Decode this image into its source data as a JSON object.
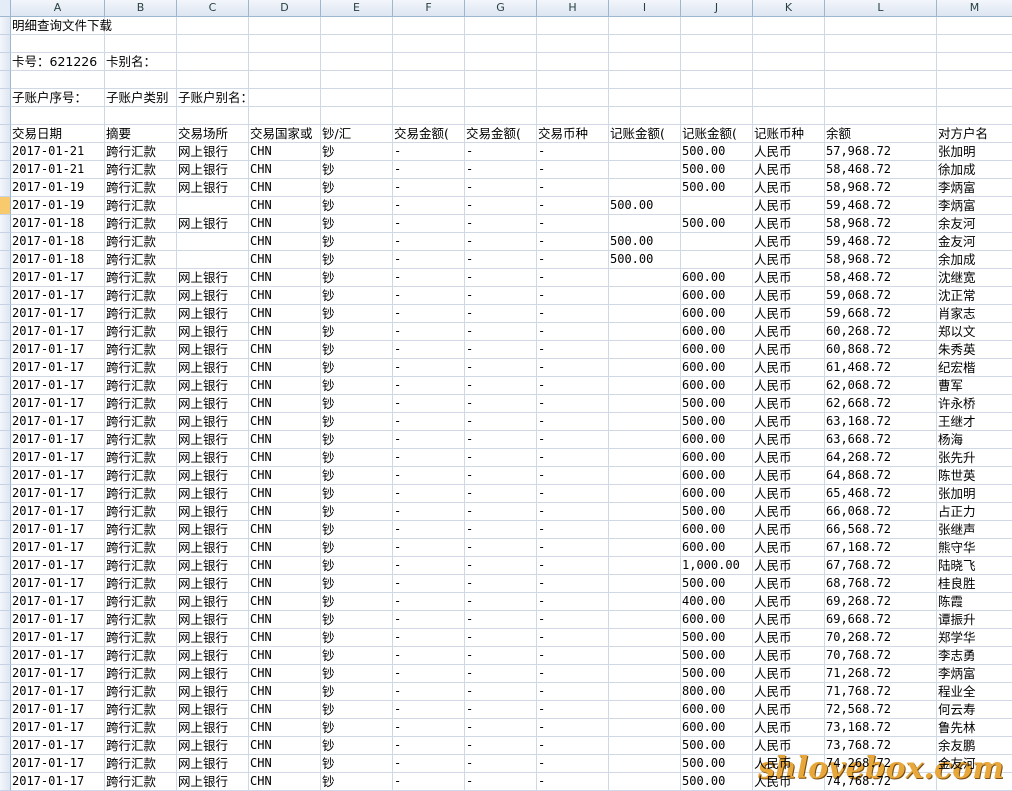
{
  "columns": [
    "A",
    "B",
    "C",
    "D",
    "E",
    "F",
    "G",
    "H",
    "I",
    "J",
    "K",
    "L",
    "M"
  ],
  "info": {
    "title": "明细查询文件下载",
    "card_no": "卡号：621226",
    "card_alias": "卡别名：",
    "sub_seq": "子账户序号：",
    "sub_type": "子账户类别",
    "sub_alias": "子账户别名："
  },
  "headers": [
    "交易日期",
    "摘要",
    "交易场所",
    "交易国家或",
    "钞/汇",
    "交易金额(",
    "交易金额(",
    "交易币种",
    "记账金额(",
    "记账金额(",
    "记账币种",
    "余额",
    "对方户名"
  ],
  "rows": [
    [
      "2017-01-21",
      "跨行汇款",
      "网上银行",
      "CHN",
      "钞",
      "-",
      "-",
      "-",
      "",
      "500.00",
      "人民币",
      "57,968.72",
      "张加明"
    ],
    [
      "2017-01-21",
      "跨行汇款",
      "网上银行",
      "CHN",
      "钞",
      "-",
      "-",
      "-",
      "",
      "500.00",
      "人民币",
      "58,468.72",
      "徐加成"
    ],
    [
      "2017-01-19",
      "跨行汇款",
      "网上银行",
      "CHN",
      "钞",
      "-",
      "-",
      "-",
      "",
      "500.00",
      "人民币",
      "58,968.72",
      "李炳富"
    ],
    [
      "2017-01-19",
      "跨行汇款",
      "",
      "CHN",
      "钞",
      "-",
      "-",
      "-",
      "500.00",
      "",
      "人民币",
      "59,468.72",
      "李炳富"
    ],
    [
      "2017-01-18",
      "跨行汇款",
      "网上银行",
      "CHN",
      "钞",
      "-",
      "-",
      "-",
      "",
      "500.00",
      "人民币",
      "58,968.72",
      "余友河"
    ],
    [
      "2017-01-18",
      "跨行汇款",
      "",
      "CHN",
      "钞",
      "-",
      "-",
      "-",
      "500.00",
      "",
      "人民币",
      "59,468.72",
      "金友河"
    ],
    [
      "2017-01-18",
      "跨行汇款",
      "",
      "CHN",
      "钞",
      "-",
      "-",
      "-",
      "500.00",
      "",
      "人民币",
      "58,968.72",
      "余加成"
    ],
    [
      "2017-01-17",
      "跨行汇款",
      "网上银行",
      "CHN",
      "钞",
      "-",
      "-",
      "-",
      "",
      "600.00",
      "人民币",
      "58,468.72",
      "沈继宽"
    ],
    [
      "2017-01-17",
      "跨行汇款",
      "网上银行",
      "CHN",
      "钞",
      "-",
      "-",
      "-",
      "",
      "600.00",
      "人民币",
      "59,068.72",
      "沈正常"
    ],
    [
      "2017-01-17",
      "跨行汇款",
      "网上银行",
      "CHN",
      "钞",
      "-",
      "-",
      "-",
      "",
      "600.00",
      "人民币",
      "59,668.72",
      "肖家志"
    ],
    [
      "2017-01-17",
      "跨行汇款",
      "网上银行",
      "CHN",
      "钞",
      "-",
      "-",
      "-",
      "",
      "600.00",
      "人民币",
      "60,268.72",
      "郑以文"
    ],
    [
      "2017-01-17",
      "跨行汇款",
      "网上银行",
      "CHN",
      "钞",
      "-",
      "-",
      "-",
      "",
      "600.00",
      "人民币",
      "60,868.72",
      "朱秀英"
    ],
    [
      "2017-01-17",
      "跨行汇款",
      "网上银行",
      "CHN",
      "钞",
      "-",
      "-",
      "-",
      "",
      "600.00",
      "人民币",
      "61,468.72",
      "纪宏楷"
    ],
    [
      "2017-01-17",
      "跨行汇款",
      "网上银行",
      "CHN",
      "钞",
      "-",
      "-",
      "-",
      "",
      "600.00",
      "人民币",
      "62,068.72",
      "曹军"
    ],
    [
      "2017-01-17",
      "跨行汇款",
      "网上银行",
      "CHN",
      "钞",
      "-",
      "-",
      "-",
      "",
      "500.00",
      "人民币",
      "62,668.72",
      "许永桥"
    ],
    [
      "2017-01-17",
      "跨行汇款",
      "网上银行",
      "CHN",
      "钞",
      "-",
      "-",
      "-",
      "",
      "500.00",
      "人民币",
      "63,168.72",
      "王继才"
    ],
    [
      "2017-01-17",
      "跨行汇款",
      "网上银行",
      "CHN",
      "钞",
      "-",
      "-",
      "-",
      "",
      "600.00",
      "人民币",
      "63,668.72",
      "杨海"
    ],
    [
      "2017-01-17",
      "跨行汇款",
      "网上银行",
      "CHN",
      "钞",
      "-",
      "-",
      "-",
      "",
      "600.00",
      "人民币",
      "64,268.72",
      "张先升"
    ],
    [
      "2017-01-17",
      "跨行汇款",
      "网上银行",
      "CHN",
      "钞",
      "-",
      "-",
      "-",
      "",
      "600.00",
      "人民币",
      "64,868.72",
      "陈世英"
    ],
    [
      "2017-01-17",
      "跨行汇款",
      "网上银行",
      "CHN",
      "钞",
      "-",
      "-",
      "-",
      "",
      "600.00",
      "人民币",
      "65,468.72",
      "张加明"
    ],
    [
      "2017-01-17",
      "跨行汇款",
      "网上银行",
      "CHN",
      "钞",
      "-",
      "-",
      "-",
      "",
      "500.00",
      "人民币",
      "66,068.72",
      "占正力"
    ],
    [
      "2017-01-17",
      "跨行汇款",
      "网上银行",
      "CHN",
      "钞",
      "-",
      "-",
      "-",
      "",
      "600.00",
      "人民币",
      "66,568.72",
      "张继声"
    ],
    [
      "2017-01-17",
      "跨行汇款",
      "网上银行",
      "CHN",
      "钞",
      "-",
      "-",
      "-",
      "",
      "600.00",
      "人民币",
      "67,168.72",
      "熊守华"
    ],
    [
      "2017-01-17",
      "跨行汇款",
      "网上银行",
      "CHN",
      "钞",
      "-",
      "-",
      "-",
      "",
      "1,000.00",
      "人民币",
      "67,768.72",
      "陆晓飞"
    ],
    [
      "2017-01-17",
      "跨行汇款",
      "网上银行",
      "CHN",
      "钞",
      "-",
      "-",
      "-",
      "",
      "500.00",
      "人民币",
      "68,768.72",
      "桂良胜"
    ],
    [
      "2017-01-17",
      "跨行汇款",
      "网上银行",
      "CHN",
      "钞",
      "-",
      "-",
      "-",
      "",
      "400.00",
      "人民币",
      "69,268.72",
      "陈霞"
    ],
    [
      "2017-01-17",
      "跨行汇款",
      "网上银行",
      "CHN",
      "钞",
      "-",
      "-",
      "-",
      "",
      "600.00",
      "人民币",
      "69,668.72",
      "谭振升"
    ],
    [
      "2017-01-17",
      "跨行汇款",
      "网上银行",
      "CHN",
      "钞",
      "-",
      "-",
      "-",
      "",
      "500.00",
      "人民币",
      "70,268.72",
      "郑学华"
    ],
    [
      "2017-01-17",
      "跨行汇款",
      "网上银行",
      "CHN",
      "钞",
      "-",
      "-",
      "-",
      "",
      "500.00",
      "人民币",
      "70,768.72",
      "李志勇"
    ],
    [
      "2017-01-17",
      "跨行汇款",
      "网上银行",
      "CHN",
      "钞",
      "-",
      "-",
      "-",
      "",
      "500.00",
      "人民币",
      "71,268.72",
      "李炳富"
    ],
    [
      "2017-01-17",
      "跨行汇款",
      "网上银行",
      "CHN",
      "钞",
      "-",
      "-",
      "-",
      "",
      "800.00",
      "人民币",
      "71,768.72",
      "程业全"
    ],
    [
      "2017-01-17",
      "跨行汇款",
      "网上银行",
      "CHN",
      "钞",
      "-",
      "-",
      "-",
      "",
      "600.00",
      "人民币",
      "72,568.72",
      "何云寿"
    ],
    [
      "2017-01-17",
      "跨行汇款",
      "网上银行",
      "CHN",
      "钞",
      "-",
      "-",
      "-",
      "",
      "600.00",
      "人民币",
      "73,168.72",
      "鲁先林"
    ],
    [
      "2017-01-17",
      "跨行汇款",
      "网上银行",
      "CHN",
      "钞",
      "-",
      "-",
      "-",
      "",
      "500.00",
      "人民币",
      "73,768.72",
      "余友鹏"
    ],
    [
      "2017-01-17",
      "跨行汇款",
      "网上银行",
      "CHN",
      "钞",
      "-",
      "-",
      "-",
      "",
      "500.00",
      "人民币",
      "74,268.72",
      "金友河"
    ],
    [
      "2017-01-17",
      "跨行汇款",
      "网上银行",
      "CHN",
      "钞",
      "-",
      "-",
      "-",
      "",
      "500.00",
      "人民币",
      "74,768.72",
      ""
    ]
  ],
  "selected_row_index": 3,
  "watermark": "shlovebox.com",
  "colors": {
    "accent": "#f8c96d",
    "header_bg": "#dde6f2",
    "grid": "#d0d7e5"
  }
}
